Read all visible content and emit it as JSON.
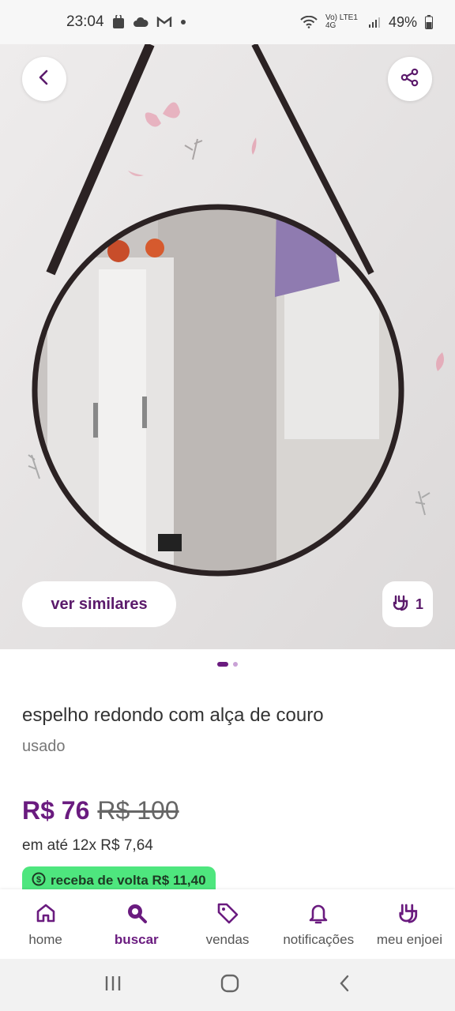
{
  "status_bar": {
    "time": "23:04",
    "battery": "49%",
    "network": "Vo) LTE1 4G"
  },
  "product": {
    "title": "espelho redondo com alça de couro",
    "condition": "usado",
    "price": "R$ 76",
    "old_price": "R$ 100",
    "installments": "em até 12x R$ 7,64",
    "cashback": "receba de volta R$ 11,40",
    "likes": "1",
    "image_count": 2,
    "current_image": 1
  },
  "hero": {
    "similar_label": "ver similares"
  },
  "bottom_nav": {
    "items": [
      {
        "label": "home",
        "icon": "home-icon"
      },
      {
        "label": "buscar",
        "icon": "search-icon"
      },
      {
        "label": "vendas",
        "icon": "tag-icon"
      },
      {
        "label": "notificações",
        "icon": "bell-icon"
      },
      {
        "label": "meu enjoei",
        "icon": "rock-hand-icon"
      }
    ]
  },
  "colors": {
    "accent": "#6a1b7f",
    "cashback_bg": "#4ee67e"
  }
}
